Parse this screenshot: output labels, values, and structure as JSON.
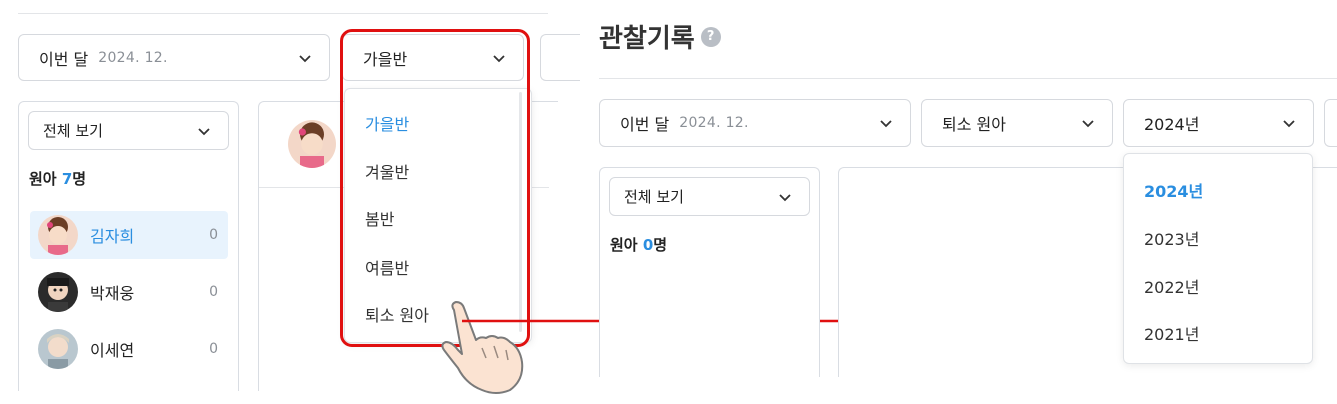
{
  "left": {
    "month_select": {
      "label": "이번 달",
      "value": "2024. 12."
    },
    "class_select": {
      "value": "가을반"
    },
    "filter_select": {
      "value": "전체 보기"
    },
    "children_count": {
      "prefix": "원아 ",
      "number": "7",
      "suffix": "명"
    },
    "children": [
      {
        "name": "김자희",
        "count": "0",
        "active": true
      },
      {
        "name": "박재웅",
        "count": "0",
        "active": false
      },
      {
        "name": "이세연",
        "count": "0",
        "active": false
      }
    ],
    "class_menu": [
      {
        "label": "가을반",
        "selected": true
      },
      {
        "label": "겨울반",
        "selected": false
      },
      {
        "label": "봄반",
        "selected": false
      },
      {
        "label": "여름반",
        "selected": false
      },
      {
        "label": "퇴소 원아",
        "selected": false
      }
    ]
  },
  "right": {
    "title": "관찰기록",
    "help_icon": "?",
    "month_select": {
      "label": "이번 달",
      "value": "2024. 12."
    },
    "class_select": {
      "value": "퇴소 원아"
    },
    "year_select": {
      "value": "2024년"
    },
    "filter_select": {
      "value": "전체 보기"
    },
    "children_count": {
      "prefix": "원아 ",
      "number": "0",
      "suffix": "명"
    },
    "year_menu": [
      {
        "label": "2024년",
        "selected": true
      },
      {
        "label": "2023년",
        "selected": false
      },
      {
        "label": "2022년",
        "selected": false
      },
      {
        "label": "2021년",
        "selected": false
      }
    ]
  },
  "colors": {
    "accent": "#2a8ee0",
    "highlight": "#e01010",
    "active_row_bg": "#e8f3fd"
  }
}
